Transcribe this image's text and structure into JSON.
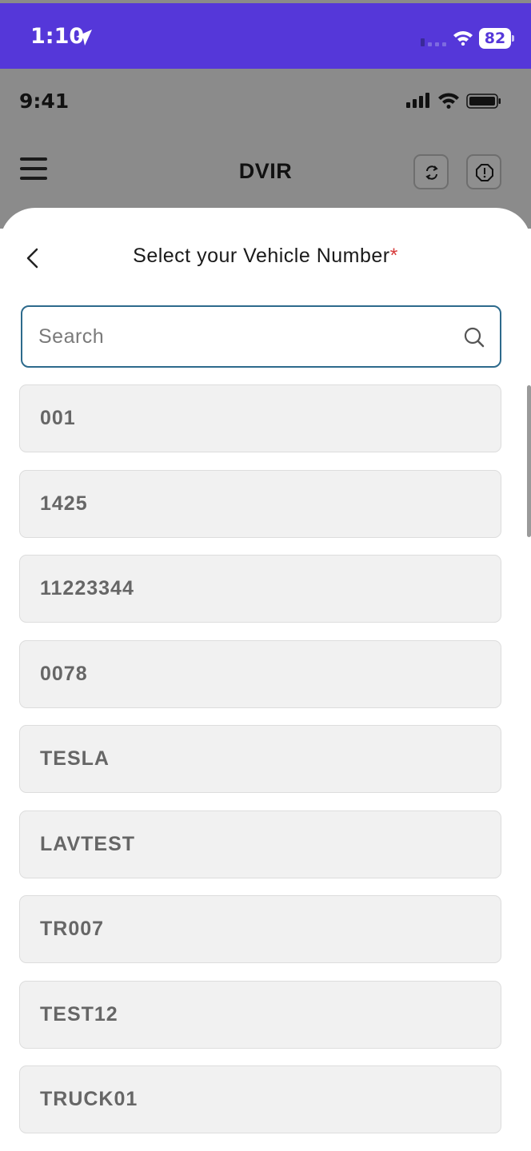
{
  "os_status": {
    "time": "1:10",
    "battery": "82",
    "location_icon": "location-arrow-icon",
    "wifi_icon": "wifi-icon"
  },
  "app_status": {
    "time": "9:41"
  },
  "header": {
    "title": "DVIR",
    "menu_icon": "hamburger-icon",
    "sync_icon": "sync-icon",
    "alert_icon": "alert-icon"
  },
  "sheet": {
    "title": "Select your Vehicle Number",
    "required_mark": "*",
    "search": {
      "placeholder": "Search",
      "value": ""
    },
    "vehicles": [
      "001",
      "1425",
      "11223344",
      "0078",
      "TESLA",
      "LAVTEST",
      "TR007",
      "TEST12",
      "TRUCK01"
    ]
  },
  "colors": {
    "os_bar": "#5537d9",
    "search_border": "#2d6a8c",
    "required": "#d63b3b",
    "item_bg": "#f1f1f1"
  }
}
